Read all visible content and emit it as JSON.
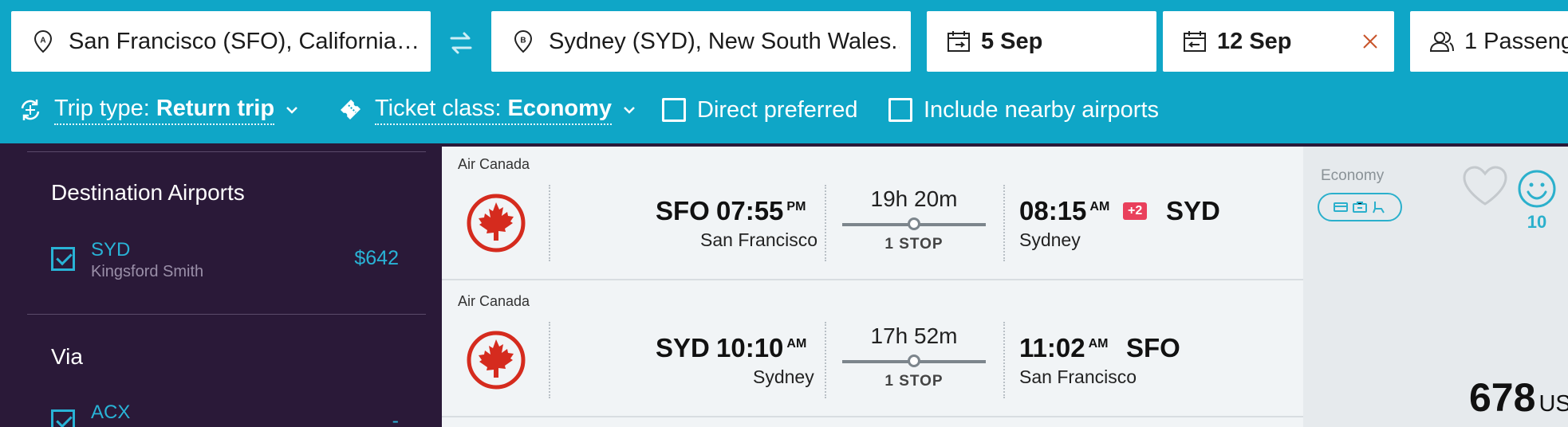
{
  "search": {
    "origin": "San Francisco (SFO), California, ...",
    "destination": "Sydney (SYD), New South Wales...",
    "depart_date": "5 Sep",
    "return_date": "12 Sep",
    "passengers": "1 Passeng"
  },
  "options": {
    "trip_type_prefix": "Trip type: ",
    "trip_type_value": "Return trip",
    "ticket_class_prefix": "Ticket class: ",
    "ticket_class_value": "Economy",
    "direct_label": "Direct preferred",
    "nearby_label": "Include nearby airports"
  },
  "sidebar": {
    "destination_heading": "Destination Airports",
    "destination_items": [
      {
        "code": "SYD",
        "name": "Kingsford Smith",
        "price": "$642"
      }
    ],
    "via_heading": "Via",
    "via_items": [
      {
        "code": "ACX",
        "price": "-"
      }
    ]
  },
  "result": {
    "legs": [
      {
        "airline": "Air Canada",
        "dep_code": "SFO",
        "dep_time": "07:55",
        "dep_ampm": "PM",
        "dep_city": "San Francisco",
        "duration": "19h 20m",
        "stops": "1 STOP",
        "arr_time": "08:15",
        "arr_ampm": "AM",
        "day_offset": "+2",
        "arr_code": "SYD",
        "arr_city": "Sydney"
      },
      {
        "airline": "Air Canada",
        "dep_code": "SYD",
        "dep_time": "10:10",
        "dep_ampm": "AM",
        "dep_city": "Sydney",
        "duration": "17h 52m",
        "stops": "1 STOP",
        "arr_time": "11:02",
        "arr_ampm": "AM",
        "arr_code": "SFO",
        "arr_city": "San Francisco"
      }
    ],
    "cabin": "Economy",
    "score": "10",
    "price": "678",
    "currency": "USD"
  },
  "colors": {
    "brand": "#0fa6c7",
    "sidebar_bg": "#2a1938",
    "accent": "#29b3d6",
    "badge": "#e9405c",
    "airline_red": "#d52b1e"
  },
  "icons": [
    "origin-pin-icon",
    "swap-icon",
    "destination-pin-icon",
    "calendar-depart-icon",
    "calendar-return-icon",
    "clear-icon",
    "passenger-icon",
    "trip-type-icon",
    "ticket-icon",
    "chevron-down-icon",
    "heart-icon",
    "smiley-icon",
    "air-canada-logo"
  ]
}
